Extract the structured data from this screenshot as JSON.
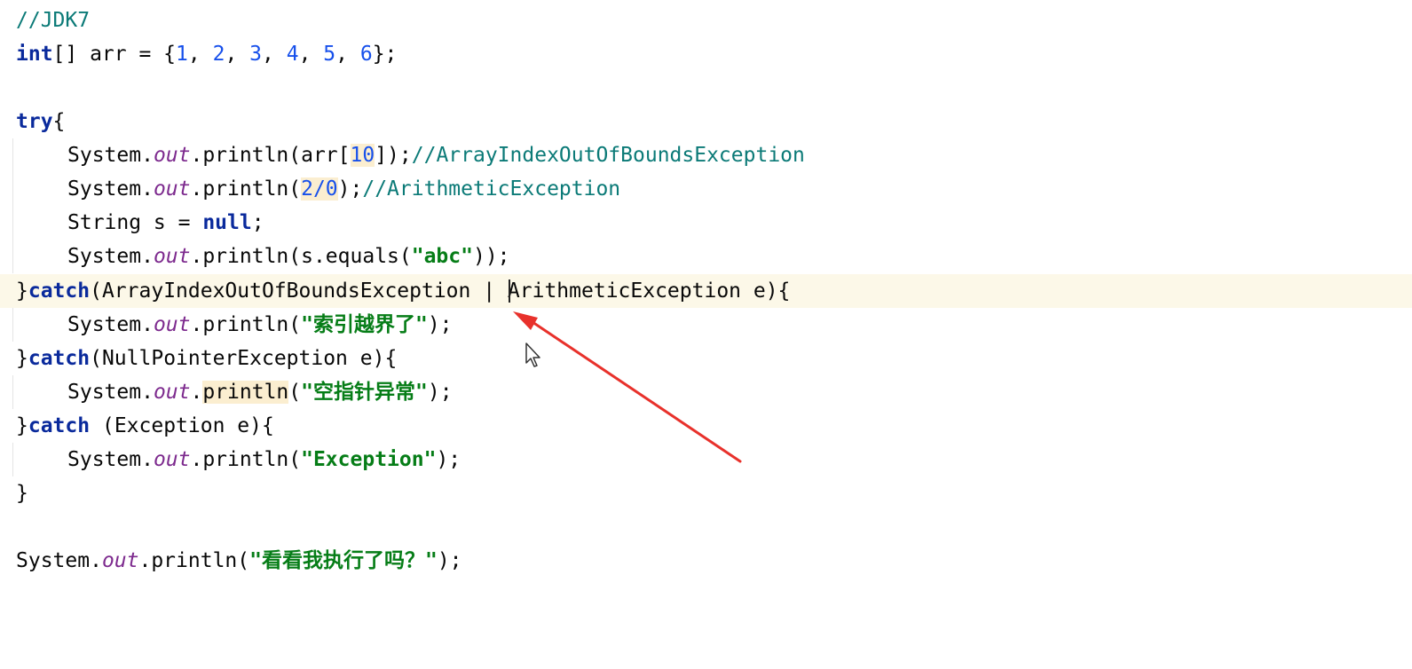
{
  "editor": {
    "comment_jdk": "//JDK7",
    "kw_int": "int",
    "arr_decl_rest": "[] arr = {",
    "n1": "1",
    "n2": "2",
    "n3": "3",
    "n4": "4",
    "n5": "5",
    "n6": "6",
    "comma": ", ",
    "arr_close": "};",
    "kw_try": "try",
    "brace_open": "{",
    "system": "System.",
    "out": "out",
    "println_open": ".println(",
    "println_word": "println",
    "dot": ".",
    "paren_open": "(",
    "arr_index_open": "arr[",
    "idx10": "10",
    "arr_index_close": "]);",
    "comment_aioobe": "//ArrayIndexOutOfBoundsException",
    "div_expr": "2/0",
    "stmt_close": ");",
    "comment_arith": "//ArithmeticException",
    "string_decl": "String s = ",
    "kw_null": "null",
    "semicolon": ";",
    "equals_open": "s.equals(",
    "str_abc": "\"abc\"",
    "equals_close": "));",
    "brace_close": "}",
    "kw_catch": "catch",
    "catch1_params": "(ArrayIndexOutOfBoundsException | ArithmeticException e){",
    "str_index_oob": "\"索引越界了\"",
    "catch2_params": "(NullPointerException e){",
    "str_npe": "\"空指针异常\"",
    "catch3_space": " ",
    "catch3_params": "(Exception e){",
    "str_exception": "\"Exception\"",
    "str_executed": "\"看看我执行了吗？\""
  },
  "annotation": {
    "arrow_color": "#e8312b"
  }
}
